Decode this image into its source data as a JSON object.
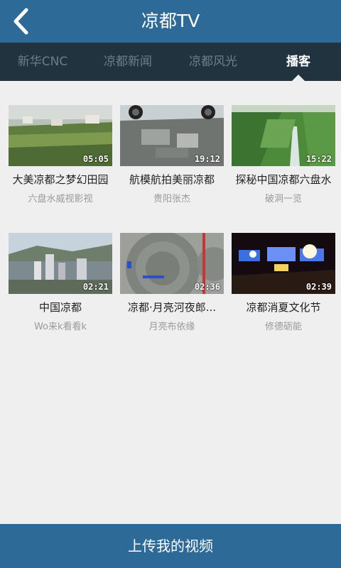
{
  "header": {
    "title": "凉都TV",
    "back_icon": "chevron-left-icon"
  },
  "tabs": [
    {
      "label": "新华CNC",
      "active": false
    },
    {
      "label": "凉都新闻",
      "active": false
    },
    {
      "label": "凉都风光",
      "active": false
    },
    {
      "label": "播客",
      "active": true
    }
  ],
  "videos": [
    {
      "title": "大美凉都之梦幻田园",
      "author": "六盘水威视影视",
      "duration": "05:05"
    },
    {
      "title": "航模航拍美丽凉都",
      "author": "贵阳张杰",
      "duration": "19:12"
    },
    {
      "title": "探秘中国凉都六盘水",
      "author": "破洞一览",
      "duration": "15:22"
    },
    {
      "title": "中国凉都",
      "author": "Wo来k看看k",
      "duration": "02:21"
    },
    {
      "title": "凉都·月亮河夜郎...",
      "author": "月亮布依缘",
      "duration": "02:36"
    },
    {
      "title": "凉都消夏文化节",
      "author": "修德砺能",
      "duration": "02:39"
    }
  ],
  "upload_button": {
    "label": "上传我的视频"
  },
  "colors": {
    "primary": "#2d6a98",
    "tabbar": "#223340",
    "background": "#efefef"
  }
}
